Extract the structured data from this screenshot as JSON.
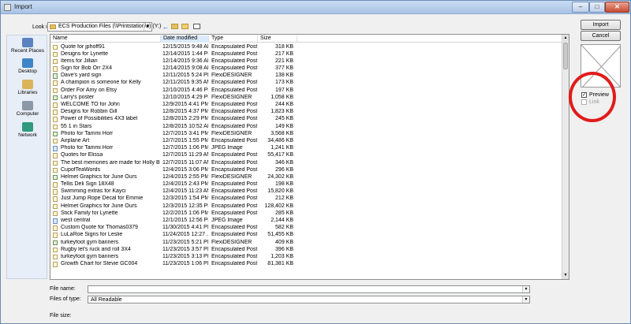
{
  "window": {
    "title": "Import",
    "minimize_glyph": "–",
    "maximize_glyph": "□",
    "close_glyph": "✕"
  },
  "toolbar": {
    "look_in_label": "Look in:",
    "look_in_value": "ECS Production Files (\\\\Printstation\\c) (Y:)",
    "combo_arrow": "▼",
    "back_glyph": "←",
    "up_icon": "up-folder-icon",
    "new_folder_icon": "new-folder-icon",
    "view_menu_icon": "view-menu-icon"
  },
  "places": [
    {
      "label": "Recent Places",
      "icon": "recent-places-icon"
    },
    {
      "label": "Desktop",
      "icon": "desktop-icon"
    },
    {
      "label": "Libraries",
      "icon": "libraries-icon"
    },
    {
      "label": "Computer",
      "icon": "computer-icon"
    },
    {
      "label": "Network",
      "icon": "network-icon"
    }
  ],
  "columns": {
    "name": "Name",
    "date": "Date modified",
    "type": "Type",
    "size": "Size",
    "sorted_column": "date"
  },
  "files": [
    {
      "name": "Quote for jphoff91",
      "date": "12/15/2015 9:48 AM",
      "type": "Encapsulated Post...",
      "size": "318 KB",
      "icon": "eps-file-icon"
    },
    {
      "name": "Designs for Lynette",
      "date": "12/14/2015 1:44 PM",
      "type": "Encapsulated Post...",
      "size": "217 KB",
      "icon": "eps-file-icon"
    },
    {
      "name": "Items for Jillian",
      "date": "12/14/2015 9:36 AM",
      "type": "Encapsulated Post...",
      "size": "221 KB",
      "icon": "eps-file-icon"
    },
    {
      "name": "Sign for Bob Orr 2X4",
      "date": "12/14/2015 9:08 AM",
      "type": "Encapsulated Post...",
      "size": "377 KB",
      "icon": "eps-file-icon"
    },
    {
      "name": "Dave's yard sign",
      "date": "12/11/2015 5:24 PM",
      "type": "FlexiDESIGNER",
      "size": "138 KB",
      "icon": "flexi-file-icon"
    },
    {
      "name": "A champion is someone for Kelly",
      "date": "12/11/2015 9:35 AM",
      "type": "Encapsulated Post...",
      "size": "173 KB",
      "icon": "eps-file-icon"
    },
    {
      "name": "Order For Amy on Etsy",
      "date": "12/10/2015 4:46 PM",
      "type": "Encapsulated Post...",
      "size": "197 KB",
      "icon": "eps-file-icon"
    },
    {
      "name": "Larry's poster",
      "date": "12/10/2015 4:29 PM",
      "type": "FlexiDESIGNER",
      "size": "1,058 KB",
      "icon": "flexi-file-icon"
    },
    {
      "name": "WELCOME TO for John",
      "date": "12/9/2015 4:41 PM",
      "type": "Encapsulated Post...",
      "size": "244 KB",
      "icon": "eps-file-icon"
    },
    {
      "name": "Designs for Robbin Gill",
      "date": "12/8/2015 4:37 PM",
      "type": "Encapsulated Post...",
      "size": "1,823 KB",
      "icon": "eps-file-icon"
    },
    {
      "name": "Power of Possibilities 4X3 label",
      "date": "12/8/2015 2:29 PM",
      "type": "Encapsulated Post...",
      "size": "245 KB",
      "icon": "eps-file-icon"
    },
    {
      "name": "55 1 in Stars",
      "date": "12/8/2015 10:52 AM",
      "type": "Encapsulated Post...",
      "size": "149 KB",
      "icon": "eps-file-icon"
    },
    {
      "name": "Photo for Tammi Horr",
      "date": "12/7/2015 3:41 PM",
      "type": "FlexiDESIGNER",
      "size": "3,568 KB",
      "icon": "flexi-file-icon"
    },
    {
      "name": "Airplane Art",
      "date": "12/7/2015 1:55 PM",
      "type": "Encapsulated Post...",
      "size": "34,486 KB",
      "icon": "eps-file-icon"
    },
    {
      "name": "Photo for Tammi Horr",
      "date": "12/7/2015 1:06 PM",
      "type": "JPEG Image",
      "size": "1,241 KB",
      "icon": "jpeg-file-icon"
    },
    {
      "name": "Quotes for Elissa",
      "date": "12/7/2015 11:29 AM",
      "type": "Encapsulated Post...",
      "size": "55,417 KB",
      "icon": "eps-file-icon"
    },
    {
      "name": "The best memories are made for Holly Blum",
      "date": "12/7/2015 11:07 AM",
      "type": "Encapsulated Post...",
      "size": "346 KB",
      "icon": "eps-file-icon"
    },
    {
      "name": "CupofTeaWords",
      "date": "12/4/2015 3:06 PM",
      "type": "Encapsulated Post...",
      "size": "296 KB",
      "icon": "eps-file-icon"
    },
    {
      "name": "Helmet Graphics for June Ours",
      "date": "12/4/2015 2:55 PM",
      "type": "FlexiDESIGNER",
      "size": "24,302 KB",
      "icon": "flexi-file-icon"
    },
    {
      "name": "Tellis Deli Sign 18X48",
      "date": "12/4/2015 2:43 PM",
      "type": "Encapsulated Post...",
      "size": "198 KB",
      "icon": "eps-file-icon"
    },
    {
      "name": "Swimming extras for Kayci",
      "date": "12/4/2015 11:23 AM",
      "type": "Encapsulated Post...",
      "size": "15,820 KB",
      "icon": "eps-file-icon"
    },
    {
      "name": "Just Jump Rope Decal for Emmie",
      "date": "12/3/2015 1:54 PM",
      "type": "Encapsulated Post...",
      "size": "212 KB",
      "icon": "eps-file-icon"
    },
    {
      "name": "Helmet Graphics for June Ours",
      "date": "12/3/2015 12:35 PM",
      "type": "Encapsulated Post...",
      "size": "128,402 KB",
      "icon": "eps-file-icon"
    },
    {
      "name": "Stick Family for Lynette",
      "date": "12/2/2015 1:06 PM",
      "type": "Encapsulated Post...",
      "size": "285 KB",
      "icon": "eps-file-icon"
    },
    {
      "name": "west central",
      "date": "12/1/2015 12:56 PM",
      "type": "JPEG Image",
      "size": "2,144 KB",
      "icon": "jpeg-file-icon"
    },
    {
      "name": "Custom Quote for Thomas0379",
      "date": "11/30/2015 4:41 PM",
      "type": "Encapsulated Post...",
      "size": "582 KB",
      "icon": "eps-file-icon"
    },
    {
      "name": "LuLaRoe Signs for Leslie",
      "date": "11/24/2015 12:27 ...",
      "type": "Encapsulated Post...",
      "size": "51,455 KB",
      "icon": "eps-file-icon"
    },
    {
      "name": "turkeyfoot gym banners",
      "date": "11/23/2015 5:21 PM",
      "type": "FlexiDESIGNER",
      "size": "409 KB",
      "icon": "flexi-file-icon"
    },
    {
      "name": "Rugby let's ruck and roll 3X4",
      "date": "11/23/2015 3:57 PM",
      "type": "Encapsulated Post...",
      "size": "396 KB",
      "icon": "eps-file-icon"
    },
    {
      "name": "turkeyfoot gym banners",
      "date": "11/23/2015 3:13 PM",
      "type": "Encapsulated Post...",
      "size": "1,203 KB",
      "icon": "eps-file-icon"
    },
    {
      "name": "Growth Chart for Stevie GC004",
      "date": "11/23/2015 1:06 PM",
      "type": "Encapsulated Post...",
      "size": "81,381 KB",
      "icon": "eps-file-icon"
    }
  ],
  "buttons": {
    "import": "Import",
    "cancel": "Cancel"
  },
  "options": {
    "preview_label": "Preview",
    "preview_checked": true,
    "link_label": "Link",
    "link_checked": false,
    "link_enabled": false,
    "check_glyph": "✓"
  },
  "bottom": {
    "file_name_label": "File name:",
    "file_name_value": "",
    "files_of_type_label": "Files of type:",
    "files_of_type_value": "All Readable",
    "file_size_label": "File size:"
  },
  "colors": {
    "highlight_circle": "#e11b1b",
    "sorted_header_bg": "#dcebfc"
  }
}
